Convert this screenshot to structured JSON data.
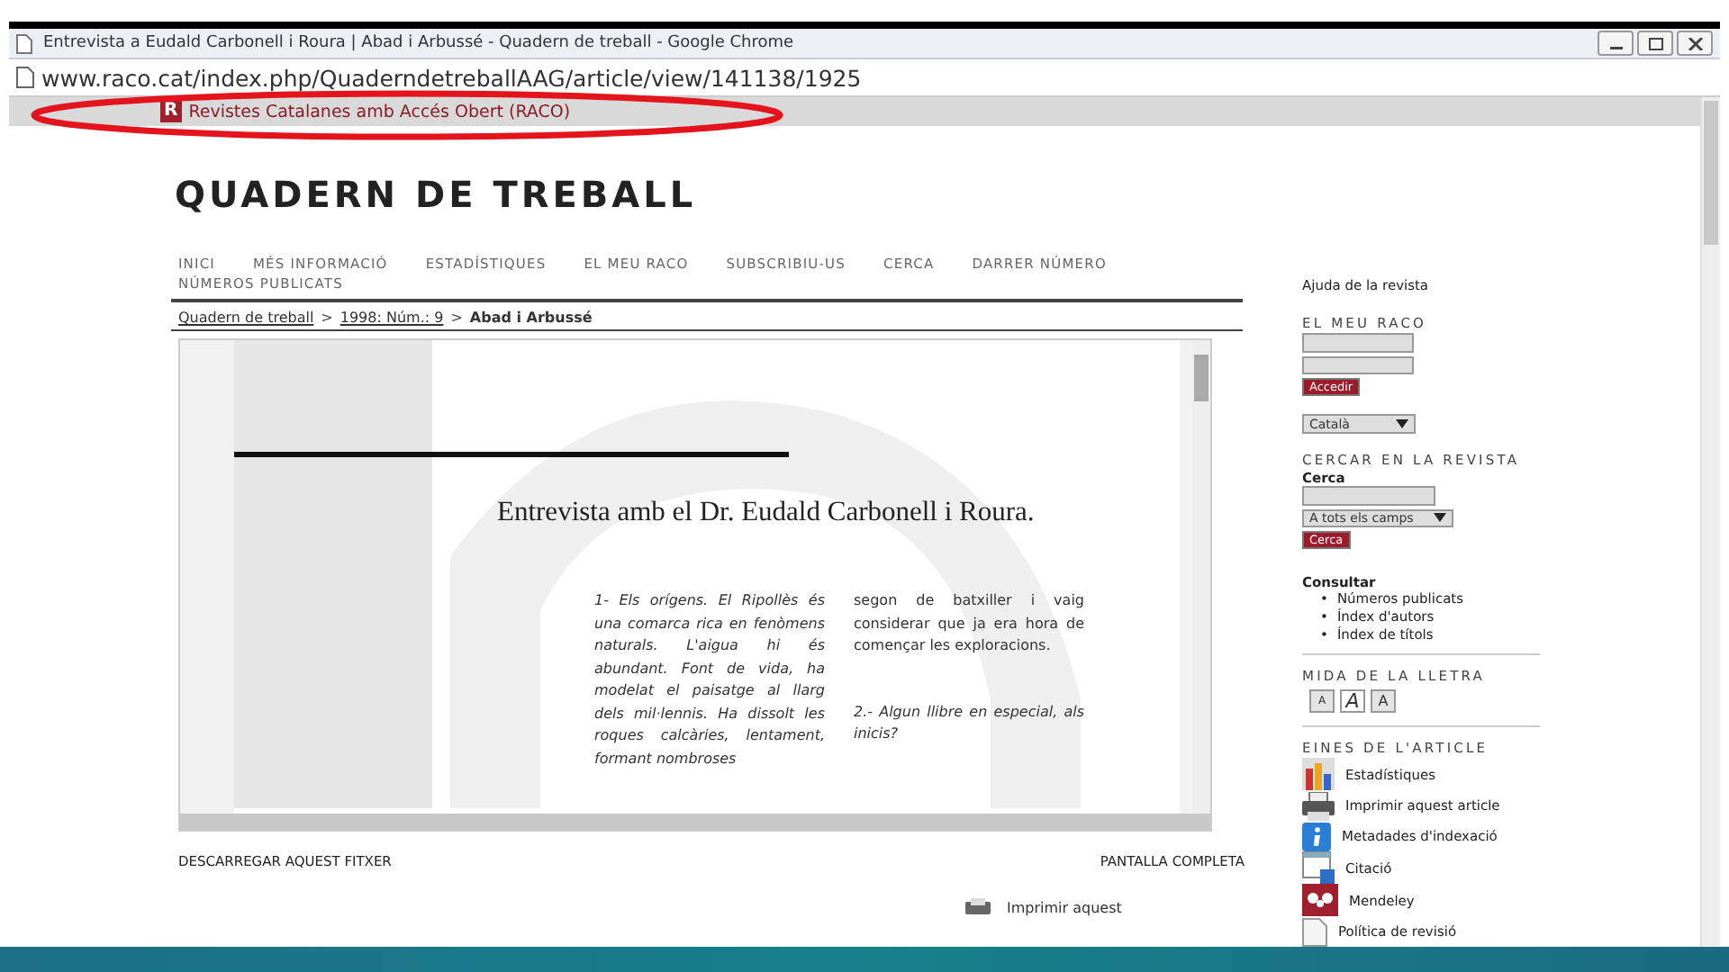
{
  "window": {
    "title": "Entrevista a Eudald Carbonell i Roura | Abad i Arbussé - Quadern de treball - Google Chrome"
  },
  "address_bar": {
    "url": "www.raco.cat/index.php/QuaderndetreballAAG/article/view/141138/1925"
  },
  "site_bar": {
    "logo": "R",
    "title": "Revistes Catalanes amb Accés Obert (RACO)"
  },
  "journal": {
    "title": "QUADERN DE TREBALL"
  },
  "nav": [
    "INICI",
    "MÉS INFORMACIÓ",
    "ESTADÍSTIQUES",
    "EL MEU RACO",
    "SUBSCRIBIU-US",
    "CERCA",
    "DARRER NÚMERO",
    "NÚMEROS PUBLICATS"
  ],
  "breadcrumb": [
    {
      "label": "Quadern de treball",
      "current": false
    },
    {
      "label": "1998: Núm.: 9",
      "current": false
    },
    {
      "label": "Abad i Arbussé",
      "current": true
    }
  ],
  "breadcrumb_separator": ">",
  "document": {
    "heading": "Entrevista amb el Dr. Eudald Carbonell i Roura.",
    "column_1": [
      "1- Els orígens. El Ripollès és una comarca rica en fenòmens naturals. L'aigua hi és abundant. Font de vida, ha modelat el paisatge al llarg dels mil·lennis. Ha dissolt les roques calcàries, lentament, formant nombroses"
    ],
    "column_2": [
      {
        "text": "segon de batxiller i vaig considerar que ja era hora de començar les exploracions.",
        "italic": false
      },
      {
        "text": "2.- Algun llibre en especial, als inicis?",
        "italic": true
      }
    ]
  },
  "footer_links": [
    "DESCARREGAR AQUEST FITXER",
    "PANTALLA COMPLETA"
  ],
  "sidebar": {
    "help": "Ajuda de la revista",
    "my_raco": {
      "heading": "EL MEU RACO",
      "button": "Accedir"
    },
    "language": "Català",
    "search": {
      "heading": "CERCAR EN LA REVISTA",
      "label": "Cerca",
      "scope": "A tots els camps",
      "button": "Cerca"
    },
    "browse": {
      "heading": "Consultar",
      "bullet": "•",
      "links": [
        "Números publicats",
        "Índex d'autors",
        "Índex de títols"
      ]
    },
    "font_size": {
      "heading": "MIDA DE LA LLETRA",
      "buttons": [
        {
          "label": "A",
          "kind": "small"
        },
        {
          "label": "A",
          "kind": "normal"
        },
        {
          "label": "A",
          "kind": "large"
        }
      ]
    },
    "tools": {
      "heading": "EINES DE L'ARTICLE",
      "items": [
        {
          "label": "Estadístiques",
          "kind": "chart"
        },
        {
          "label": "Imprimir aquest article",
          "kind": "printer"
        },
        {
          "label": "Metadades d'indexació",
          "kind": "info"
        },
        {
          "label": "Citació",
          "kind": "citation"
        },
        {
          "label": "Mendeley",
          "kind": "mendeley"
        },
        {
          "label": "Política de revisió",
          "kind": "document"
        }
      ]
    }
  },
  "overlap": {
    "label": "Imprimir aquest"
  }
}
